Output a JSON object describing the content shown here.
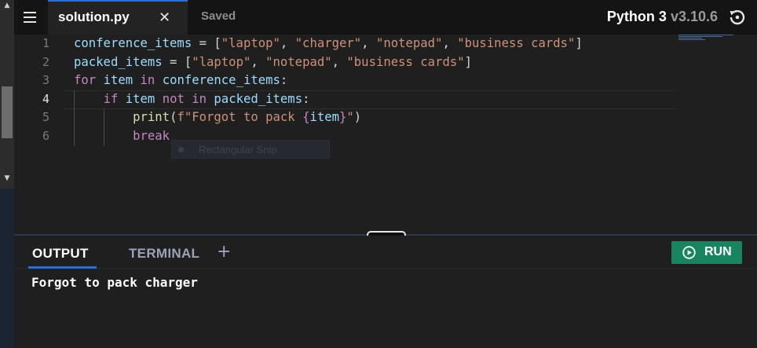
{
  "header": {
    "file_tab": "solution.py",
    "close_glyph": "✕",
    "save_status": "Saved",
    "language": "Python 3",
    "version": "v3.10.6"
  },
  "editor": {
    "line_numbers": [
      "1",
      "2",
      "3",
      "4",
      "5",
      "6"
    ],
    "active_line": 4,
    "lines": [
      [
        {
          "t": "conference_items",
          "c": "var"
        },
        {
          "t": " = [",
          "c": "pun"
        },
        {
          "t": "\"laptop\"",
          "c": "str"
        },
        {
          "t": ", ",
          "c": "pun"
        },
        {
          "t": "\"charger\"",
          "c": "str"
        },
        {
          "t": ", ",
          "c": "pun"
        },
        {
          "t": "\"notepad\"",
          "c": "str"
        },
        {
          "t": ", ",
          "c": "pun"
        },
        {
          "t": "\"business cards\"",
          "c": "str"
        },
        {
          "t": "]",
          "c": "pun"
        }
      ],
      [
        {
          "t": "packed_items",
          "c": "var"
        },
        {
          "t": " = [",
          "c": "pun"
        },
        {
          "t": "\"laptop\"",
          "c": "str"
        },
        {
          "t": ", ",
          "c": "pun"
        },
        {
          "t": "\"notepad\"",
          "c": "str"
        },
        {
          "t": ", ",
          "c": "pun"
        },
        {
          "t": "\"business cards\"",
          "c": "str"
        },
        {
          "t": "]",
          "c": "pun"
        }
      ],
      [
        {
          "t": "for",
          "c": "kw"
        },
        {
          "t": " ",
          "c": "pun"
        },
        {
          "t": "item",
          "c": "var"
        },
        {
          "t": " ",
          "c": "pun"
        },
        {
          "t": "in",
          "c": "kw"
        },
        {
          "t": " ",
          "c": "pun"
        },
        {
          "t": "conference_items",
          "c": "var"
        },
        {
          "t": ":",
          "c": "pun"
        }
      ],
      [
        {
          "t": "    ",
          "c": "pun"
        },
        {
          "t": "if",
          "c": "kw"
        },
        {
          "t": " ",
          "c": "pun"
        },
        {
          "t": "item",
          "c": "var"
        },
        {
          "t": " ",
          "c": "pun"
        },
        {
          "t": "not",
          "c": "kw"
        },
        {
          "t": " ",
          "c": "pun"
        },
        {
          "t": "in",
          "c": "kw"
        },
        {
          "t": " ",
          "c": "pun"
        },
        {
          "t": "packed_items",
          "c": "var"
        },
        {
          "t": ":",
          "c": "pun"
        }
      ],
      [
        {
          "t": "        ",
          "c": "pun"
        },
        {
          "t": "print",
          "c": "fn"
        },
        {
          "t": "(",
          "c": "pun"
        },
        {
          "t": "f\"Forgot to pack ",
          "c": "str"
        },
        {
          "t": "{",
          "c": "kw"
        },
        {
          "t": "item",
          "c": "var"
        },
        {
          "t": "}",
          "c": "kw"
        },
        {
          "t": "\"",
          "c": "str"
        },
        {
          "t": ")",
          "c": "pun"
        }
      ],
      [
        {
          "t": "        ",
          "c": "pun"
        },
        {
          "t": "break",
          "c": "kw"
        }
      ]
    ],
    "overlay_text": "Rectangular Snip"
  },
  "panel": {
    "tab_output": "OUTPUT",
    "tab_terminal": "TERMINAL",
    "add_tab_glyph": "+",
    "run_label": "RUN",
    "output_text": "Forgot to pack charger"
  },
  "colors": {
    "accent": "#2d6fd6",
    "run_button": "#188560",
    "keyword": "#c586c0",
    "string": "#ce9178",
    "variable": "#9cdcfe"
  }
}
